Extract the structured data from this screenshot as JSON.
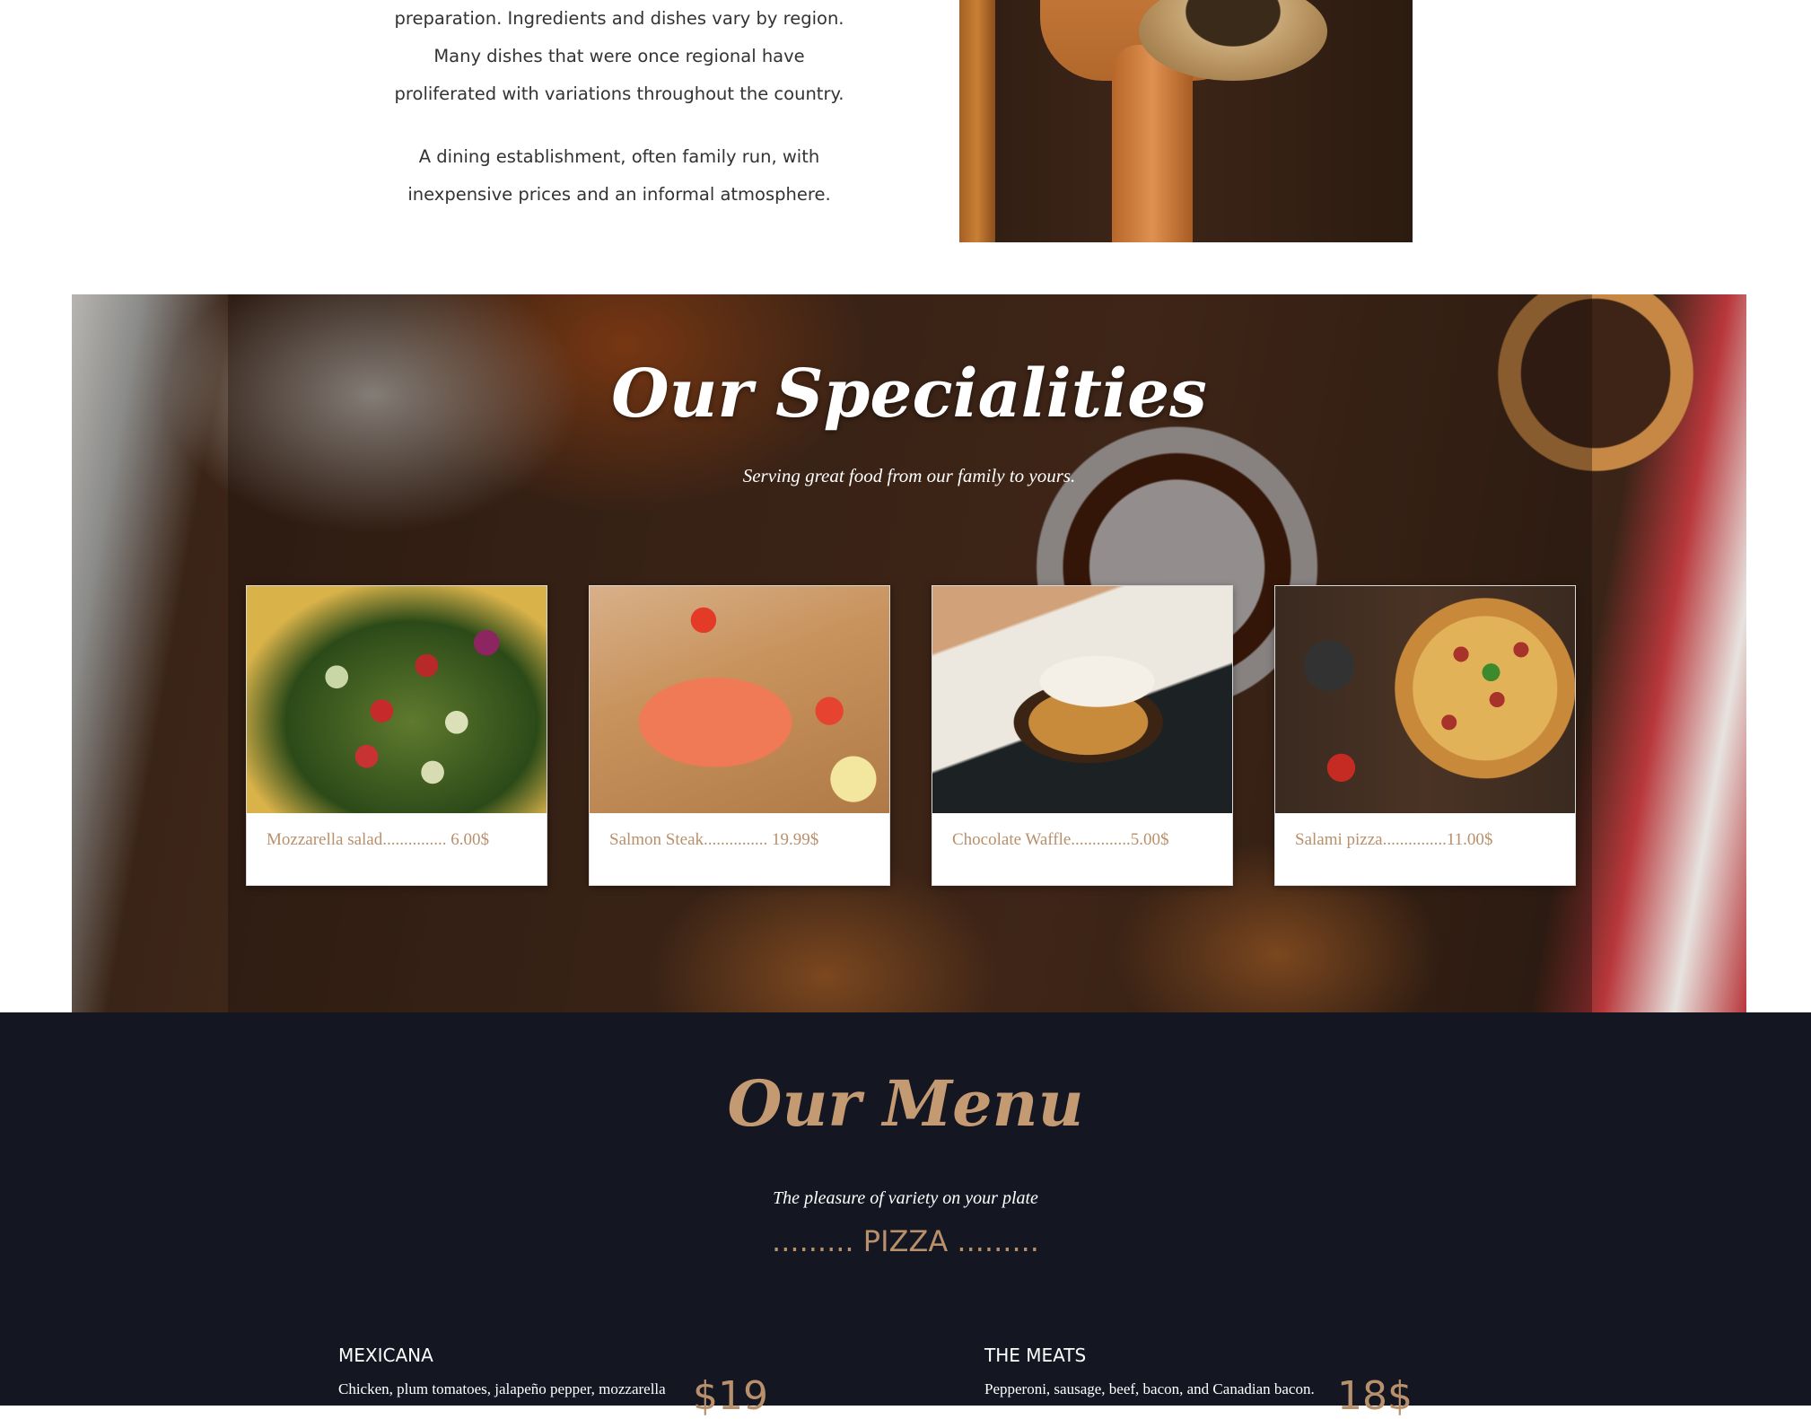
{
  "intro": {
    "paragraph_lines": [
      "preparation. Ingredients and dishes vary by region.",
      "Many dishes that were once regional have",
      "proliferated with variations throughout the country."
    ],
    "paragraph2_lines": [
      "A dining establishment, often family run, with",
      "inexpensive prices and an informal atmosphere."
    ]
  },
  "specialities": {
    "title": "Our Specialities",
    "subtitle": "Serving great food from our family to yours.",
    "items": [
      {
        "caption": "Mozzarella salad............... 6.00$"
      },
      {
        "caption": "Salmon Steak............... 19.99$"
      },
      {
        "caption": "Chocolate Waffle..............5.00$"
      },
      {
        "caption": "Salami pizza...............11.00$"
      }
    ]
  },
  "menu": {
    "title": "Our Menu",
    "subtitle": "The pleasure of variety on your plate",
    "category": "......... PIZZA .........",
    "items": [
      {
        "name": "MEXICANA",
        "description": "Chicken, plum tomatoes, jalapeño pepper, mozzarella",
        "price": "$19"
      },
      {
        "name": "THE MEATS",
        "description": "Pepperoni, sausage, beef, bacon, and Canadian bacon.",
        "price": "18$"
      }
    ]
  }
}
